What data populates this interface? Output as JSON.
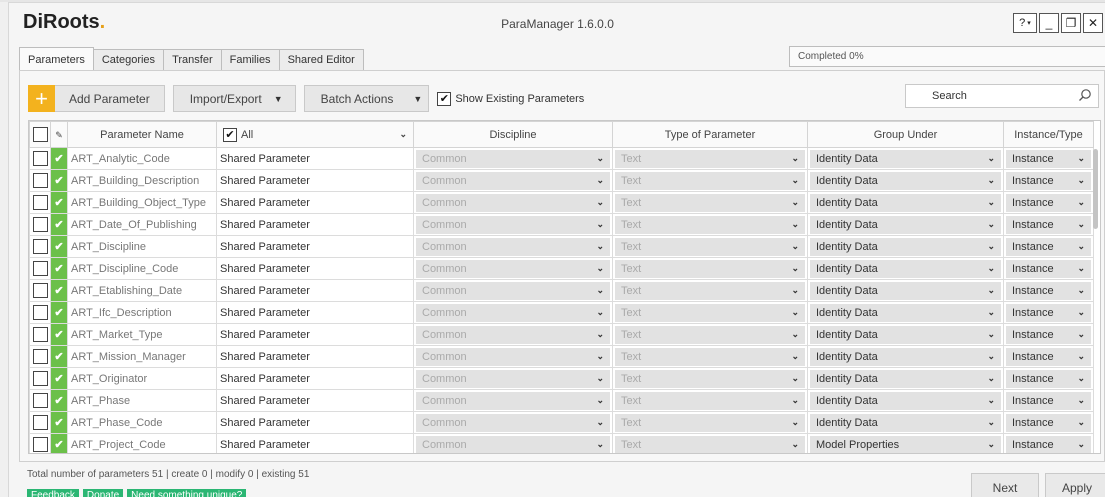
{
  "app": {
    "logo": "DiRoots",
    "title": "ParaManager 1.6.0.0"
  },
  "window_controls": {
    "help": "?",
    "minimize": "_",
    "restore": "❐",
    "close": "✕"
  },
  "tabs": [
    {
      "label": "Parameters",
      "active": true
    },
    {
      "label": "Categories"
    },
    {
      "label": "Transfer"
    },
    {
      "label": "Families"
    },
    {
      "label": "Shared Editor"
    }
  ],
  "progress": {
    "text": "Completed 0%"
  },
  "toolbar": {
    "add_parameter": "Add Parameter",
    "import_export": "Import/Export",
    "batch_actions": "Batch Actions",
    "show_existing": "Show Existing Parameters",
    "show_existing_checked": true
  },
  "search": {
    "placeholder": "Search"
  },
  "table": {
    "headers": {
      "name": "Parameter Name",
      "filter": "All",
      "discipline": "Discipline",
      "type": "Type of Parameter",
      "group": "Group Under",
      "instance": "Instance/Type"
    },
    "rows": [
      {
        "name": "ART_Analytic_Code",
        "ptype": "Shared Parameter",
        "discipline": "Common",
        "type": "Text",
        "group": "Identity Data",
        "inst": "Instance"
      },
      {
        "name": "ART_Building_Description",
        "ptype": "Shared Parameter",
        "discipline": "Common",
        "type": "Text",
        "group": "Identity Data",
        "inst": "Instance"
      },
      {
        "name": "ART_Building_Object_Type",
        "ptype": "Shared Parameter",
        "discipline": "Common",
        "type": "Text",
        "group": "Identity Data",
        "inst": "Instance"
      },
      {
        "name": "ART_Date_Of_Publishing",
        "ptype": "Shared Parameter",
        "discipline": "Common",
        "type": "Text",
        "group": "Identity Data",
        "inst": "Instance"
      },
      {
        "name": "ART_Discipline",
        "ptype": "Shared Parameter",
        "discipline": "Common",
        "type": "Text",
        "group": "Identity Data",
        "inst": "Instance"
      },
      {
        "name": "ART_Discipline_Code",
        "ptype": "Shared Parameter",
        "discipline": "Common",
        "type": "Text",
        "group": "Identity Data",
        "inst": "Instance"
      },
      {
        "name": "ART_Etablishing_Date",
        "ptype": "Shared Parameter",
        "discipline": "Common",
        "type": "Text",
        "group": "Identity Data",
        "inst": "Instance"
      },
      {
        "name": "ART_Ifc_Description",
        "ptype": "Shared Parameter",
        "discipline": "Common",
        "type": "Text",
        "group": "Identity Data",
        "inst": "Instance"
      },
      {
        "name": "ART_Market_Type",
        "ptype": "Shared Parameter",
        "discipline": "Common",
        "type": "Text",
        "group": "Identity Data",
        "inst": "Instance"
      },
      {
        "name": "ART_Mission_Manager",
        "ptype": "Shared Parameter",
        "discipline": "Common",
        "type": "Text",
        "group": "Identity Data",
        "inst": "Instance"
      },
      {
        "name": "ART_Originator",
        "ptype": "Shared Parameter",
        "discipline": "Common",
        "type": "Text",
        "group": "Identity Data",
        "inst": "Instance"
      },
      {
        "name": "ART_Phase",
        "ptype": "Shared Parameter",
        "discipline": "Common",
        "type": "Text",
        "group": "Identity Data",
        "inst": "Instance"
      },
      {
        "name": "ART_Phase_Code",
        "ptype": "Shared Parameter",
        "discipline": "Common",
        "type": "Text",
        "group": "Identity Data",
        "inst": "Instance"
      },
      {
        "name": "ART_Project_Code",
        "ptype": "Shared Parameter",
        "discipline": "Common",
        "type": "Text",
        "group": "Model Properties",
        "inst": "Instance"
      }
    ]
  },
  "footer": {
    "summary": "Total number of parameters 51 | create 0 | modify 0 | existing 51",
    "feedback": "Feedback",
    "donate": "Donate",
    "need_unique": "Need something unique?",
    "next": "Next",
    "apply": "Apply"
  },
  "colors": {
    "accent": "#f3b21e",
    "ok": "#6cc04a",
    "pill": "#2bb673"
  }
}
